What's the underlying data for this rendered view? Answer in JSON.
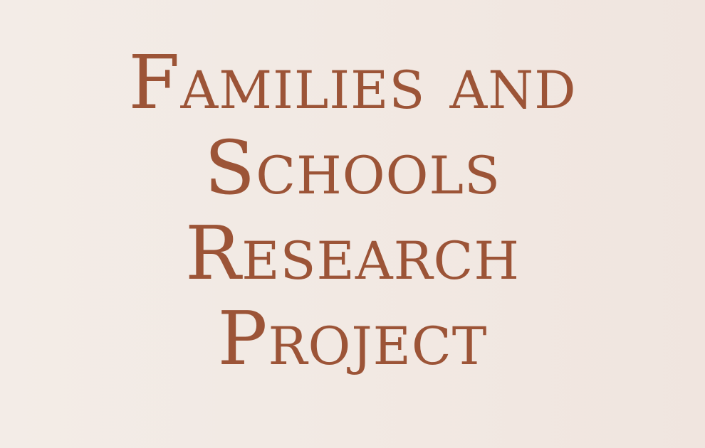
{
  "colors": {
    "text": "#9c5437",
    "background": "#f2e9e3"
  },
  "title": {
    "lines": [
      "Families and",
      "Schools",
      "Research",
      "Project"
    ]
  }
}
